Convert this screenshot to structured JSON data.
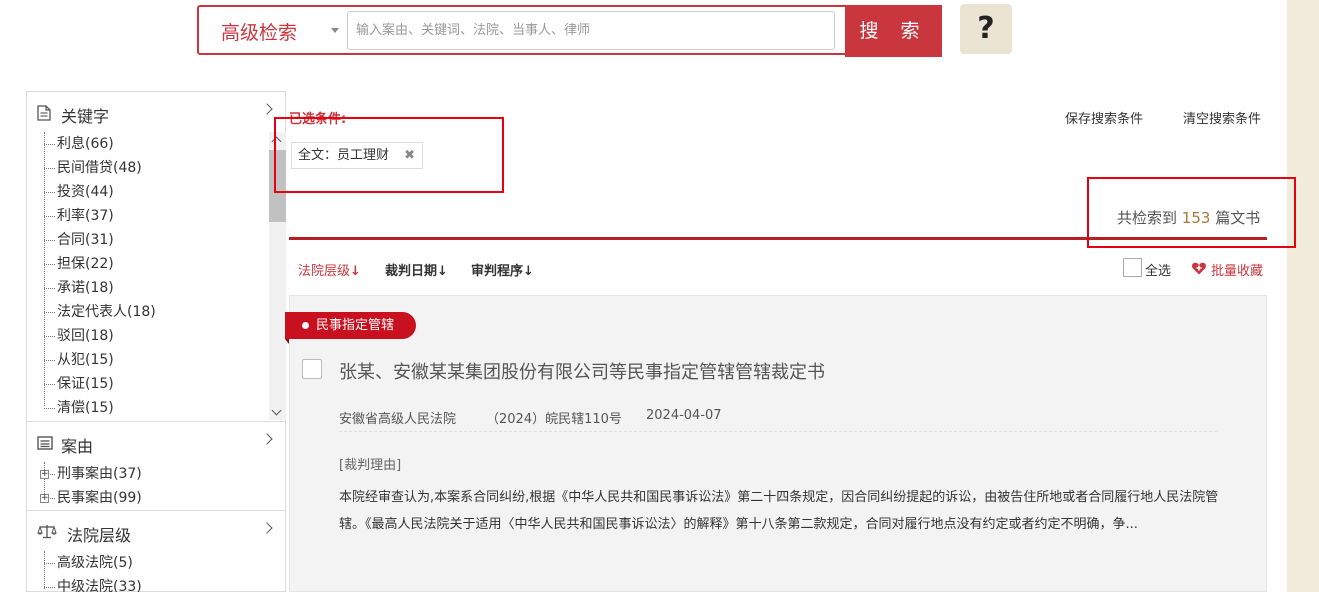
{
  "search": {
    "advanced_label": "高级检索",
    "placeholder": "输入案由、关键词、法院、当事人、律师",
    "button_label": "搜 索",
    "help_label": "?"
  },
  "sidebar": {
    "sections": [
      {
        "title": "关键字",
        "icon": "document-icon",
        "items": [
          "利息(66)",
          "民间借贷(48)",
          "投资(44)",
          "利率(37)",
          "合同(31)",
          "担保(22)",
          "承诺(18)",
          "法定代表人(18)",
          "驳回(18)",
          "从犯(15)",
          "保证(15)",
          "清偿(15)"
        ]
      },
      {
        "title": "案由",
        "icon": "list-icon",
        "items": [
          "刑事案由(37)",
          "民事案由(99)"
        ]
      },
      {
        "title": "法院层级",
        "icon": "scales-icon",
        "items": [
          "高级法院(5)",
          "中级法院(33)"
        ]
      }
    ]
  },
  "conditions": {
    "label": "已选条件:",
    "save_label": "保存搜索条件",
    "clear_label": "清空搜索条件",
    "chip": "全文：员工理财",
    "chip_remove": "✖"
  },
  "results": {
    "count_prefix": "共检索到 ",
    "count": "153",
    "count_suffix": " 篇文书"
  },
  "sort": {
    "options": [
      {
        "label": "法院层级",
        "arrow": "↓"
      },
      {
        "label": "裁判日期",
        "arrow": "↓"
      },
      {
        "label": "审判程序",
        "arrow": "↓"
      }
    ],
    "select_all": "全选",
    "batch_collect": "批量收藏"
  },
  "card": {
    "tag": "民事指定管辖",
    "title": "张某、安徽某某集团股份有限公司等民事指定管辖管辖裁定书",
    "court": "安徽省高级人民法院",
    "case_no": "（2024）皖民辖110号",
    "date": "2024-04-07",
    "reason_label": "[裁判理由]",
    "reason_text": "本院经审查认为,本案系合同纠纷,根据《中华人民共和国民事诉讼法》第二十四条规定，因合同纠纷提起的诉讼，由被告住所地或者合同履行地人民法院管辖。《最高人民法院关于适用〈中华人民共和国民事诉讼法〉的解释》第十八条第二款规定，合同对履行地点没有约定或者约定不明确，争..."
  },
  "colors": {
    "accent": "#c9363e",
    "highlight_box": "#e60012",
    "count_number": "#a77a3c"
  }
}
